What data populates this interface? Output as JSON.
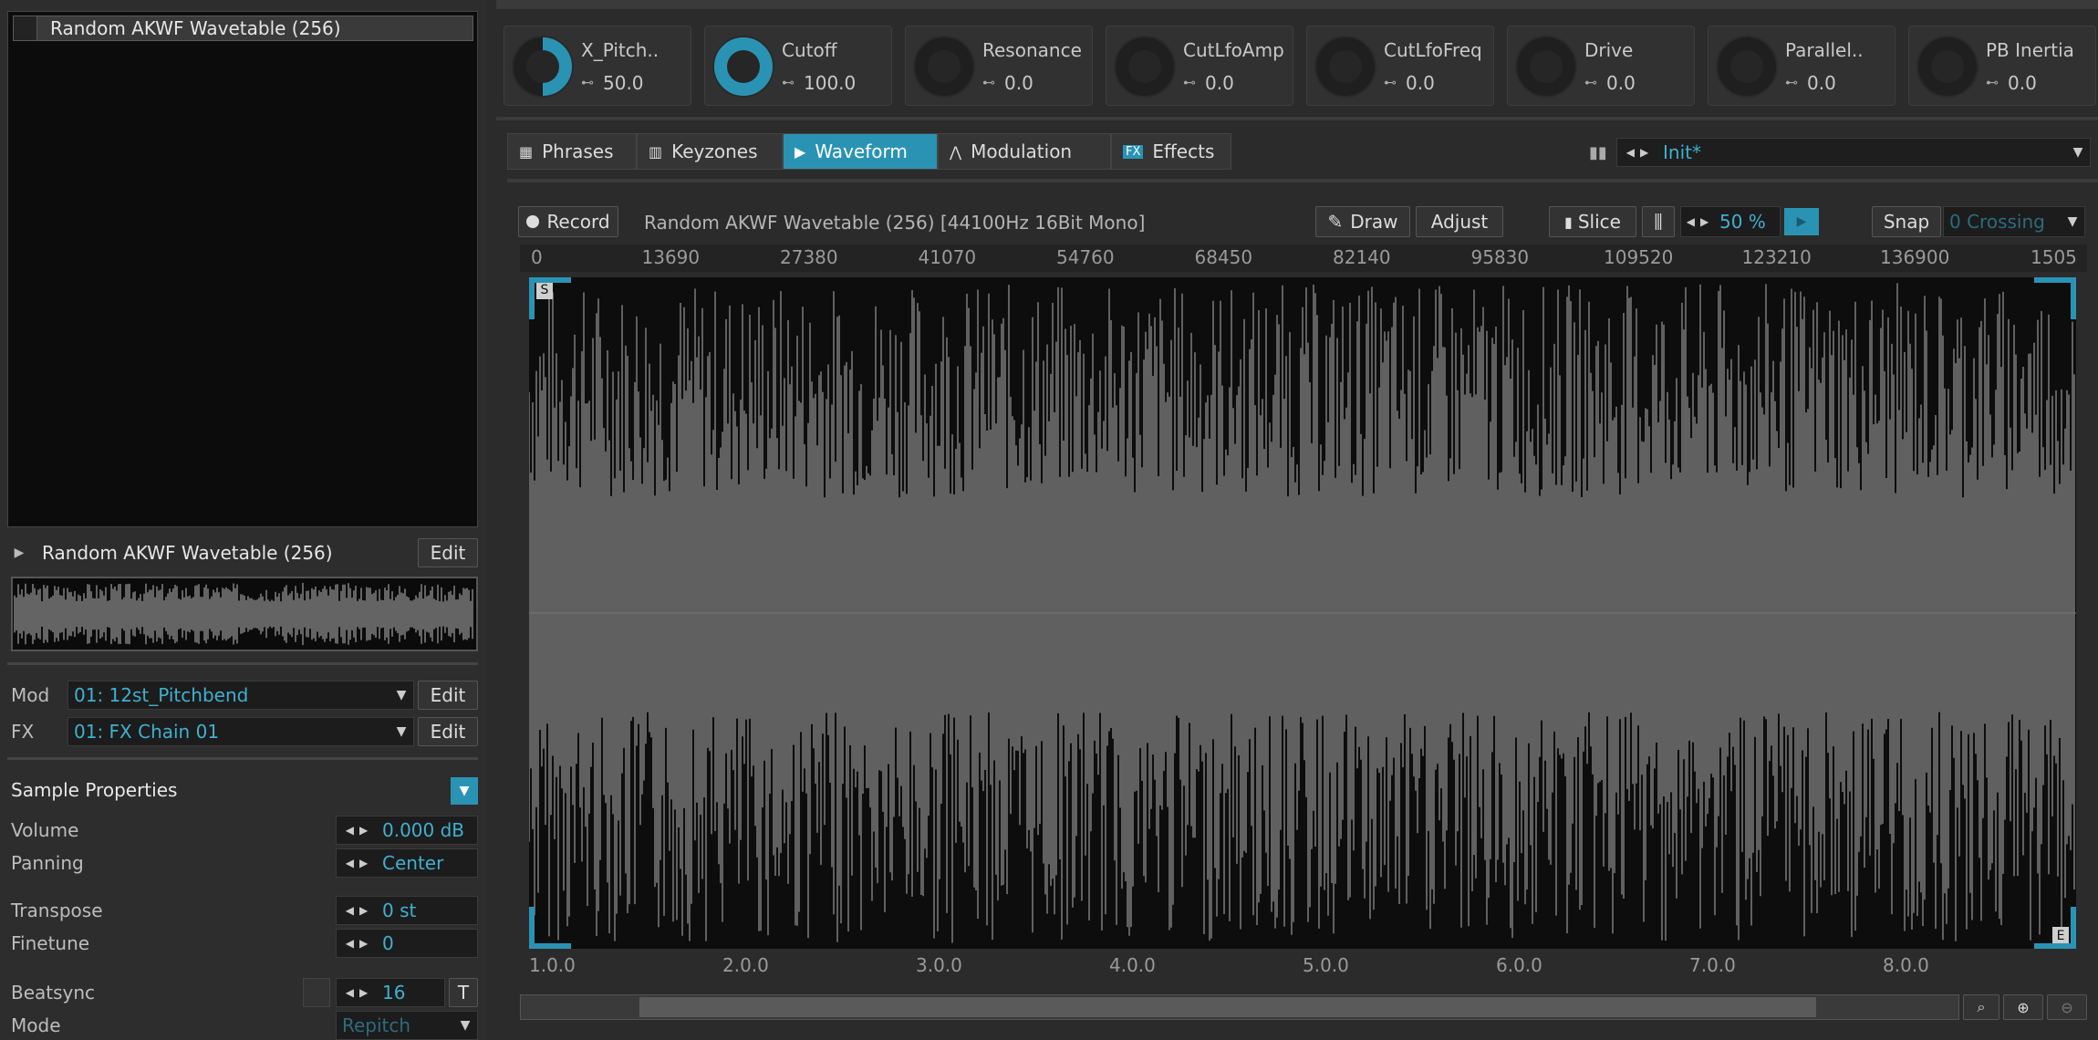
{
  "left": {
    "sample_list": [
      "Random AKWF Wavetable (256)"
    ],
    "selected_sample": "Random AKWF Wavetable (256)",
    "edit_label": "Edit",
    "mod": {
      "label": "Mod",
      "value": "01: 12st_Pitchbend",
      "edit": "Edit"
    },
    "fx": {
      "label": "FX",
      "value": "01: FX Chain 01",
      "edit": "Edit"
    },
    "sample_properties": {
      "title": "Sample Properties",
      "volume": {
        "label": "Volume",
        "value": "0.000 dB"
      },
      "panning": {
        "label": "Panning",
        "value": "Center"
      },
      "transpose": {
        "label": "Transpose",
        "value": "0 st"
      },
      "finetune": {
        "label": "Finetune",
        "value": "0"
      },
      "beatsync": {
        "label": "Beatsync",
        "value": "16",
        "toggle": "T"
      },
      "mode": {
        "label": "Mode",
        "value": "Repitch"
      }
    }
  },
  "macros": [
    {
      "name": "X_Pitch..",
      "value": "50.0",
      "fraction": 0.5
    },
    {
      "name": "Cutoff",
      "value": "100.0",
      "fraction": 1.0
    },
    {
      "name": "Resonance",
      "value": "0.0",
      "fraction": 0
    },
    {
      "name": "CutLfoAmp",
      "value": "0.0",
      "fraction": 0
    },
    {
      "name": "CutLfoFreq",
      "value": "0.0",
      "fraction": 0
    },
    {
      "name": "Drive",
      "value": "0.0",
      "fraction": 0
    },
    {
      "name": "Parallel..",
      "value": "0.0",
      "fraction": 0
    },
    {
      "name": "PB Inertia",
      "value": "0.0",
      "fraction": 0
    }
  ],
  "tabs": [
    {
      "label": "Phrases",
      "icon": "grid-icon"
    },
    {
      "label": "Keyzones",
      "icon": "keys-icon"
    },
    {
      "label": "Waveform",
      "icon": "waveform-icon",
      "active": true
    },
    {
      "label": "Modulation",
      "icon": "envelope-icon"
    },
    {
      "label": "Effects",
      "icon": "fx-icon"
    }
  ],
  "preset": {
    "value": "Init*"
  },
  "waveform": {
    "record": "Record",
    "info": "Random AKWF Wavetable (256) [44100Hz 16Bit Mono]",
    "draw": "Draw",
    "adjust": "Adjust",
    "slice": "Slice",
    "zoom": "50 %",
    "snap": "Snap",
    "snap_mode": "0 Crossing",
    "ruler_top": [
      "0",
      "13690",
      "27380",
      "41070",
      "54760",
      "68450",
      "82140",
      "95830",
      "109520",
      "123210",
      "136900",
      "1505"
    ],
    "ruler_bottom": [
      "1.0.0",
      "2.0.0",
      "3.0.0",
      "4.0.0",
      "5.0.0",
      "6.0.0",
      "7.0.0",
      "8.0.0"
    ],
    "start_marker": "S",
    "end_marker": "E"
  },
  "colors": {
    "accent": "#2a93b4",
    "value_text": "#3fb0d0",
    "wave": "#cfcfcf"
  }
}
